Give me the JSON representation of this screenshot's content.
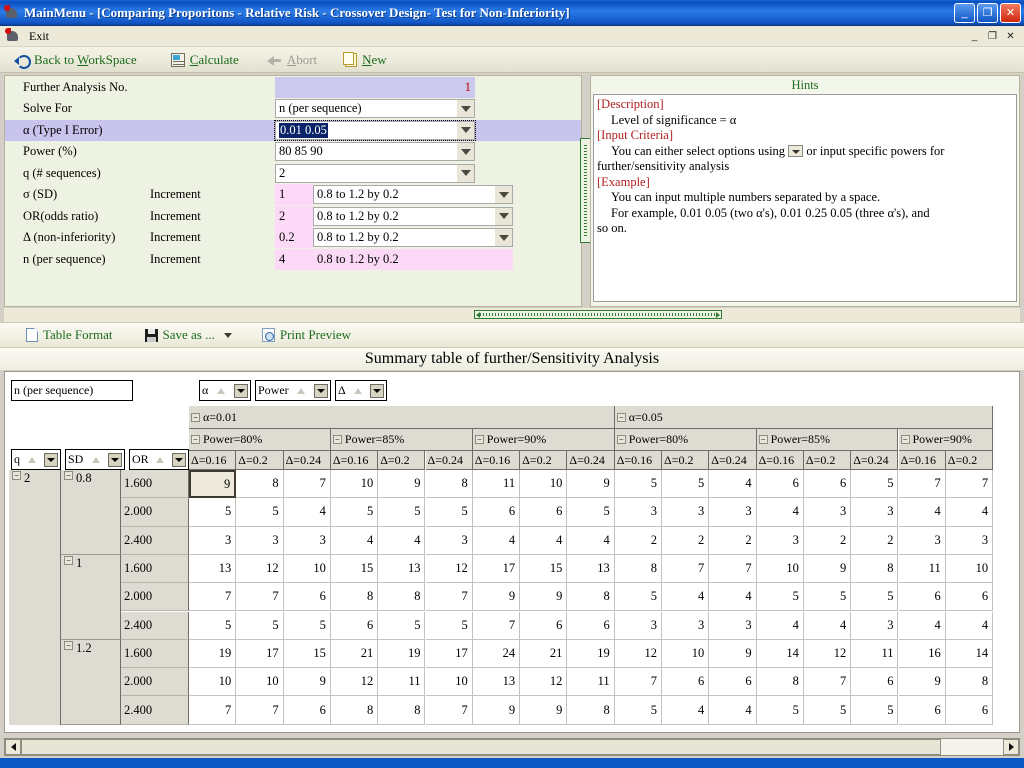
{
  "window": {
    "title": "MainMenu - [Comparing Proporitons - Relative Risk - Crossover Design- Test for Non-Inferiority]",
    "app_icon": "app-icon",
    "minimize": "_",
    "maximize": "❐",
    "close": "✕",
    "mdi_minimize": "_",
    "mdi_restore": "❐",
    "mdi_close": "✕"
  },
  "menu": {
    "exit_label": "Exit",
    "exit_icon": "exit-icon"
  },
  "toolbar": {
    "items": [
      {
        "label_pre": "Back to ",
        "label_u": "W",
        "label_post": "orkSpace",
        "icon": "back-arrow-icon",
        "disabled": false
      },
      {
        "label_pre": "",
        "label_u": "C",
        "label_post": "alculate",
        "icon": "calculate-icon",
        "disabled": false
      },
      {
        "label_pre": "",
        "label_u": "A",
        "label_post": "bort",
        "icon": "abort-icon",
        "disabled": true
      },
      {
        "label_pre": "",
        "label_u": "N",
        "label_post": "ew",
        "icon": "new-document-icon",
        "disabled": false
      }
    ]
  },
  "form": {
    "rows": [
      {
        "name": "Further Analysis No.",
        "increment": "",
        "value": "1",
        "kind": "readonly-number"
      },
      {
        "name": "Solve For",
        "increment": "",
        "value": "n (per sequence)",
        "kind": "combo"
      },
      {
        "name": "α (Type I Error)",
        "increment": "",
        "value": "0.01 0.05",
        "kind": "combo-selected",
        "highlight": true
      },
      {
        "name": "Power (%)",
        "increment": "",
        "value": "80 85 90",
        "kind": "combo"
      },
      {
        "name": "q (# sequences)",
        "increment": "",
        "value": "2",
        "kind": "combo"
      },
      {
        "name": "σ (SD)",
        "increment": "Increment",
        "value": "1",
        "range": "0.8 to 1.2 by 0.2",
        "kind": "inc-combo"
      },
      {
        "name": "OR(odds ratio)",
        "increment": "Increment",
        "value": "2",
        "range": "0.8 to 1.2 by 0.2",
        "kind": "inc-combo"
      },
      {
        "name": "Δ (non-inferiority)",
        "increment": "Increment",
        "value": "0.2",
        "range": "0.8 to 1.2 by 0.2",
        "kind": "inc-combo"
      },
      {
        "name": "n (per sequence)",
        "increment": "Increment",
        "value": "4",
        "range": "0.8 to 1.2 by 0.2",
        "kind": "inc-disabled"
      }
    ]
  },
  "hints": {
    "title": "Hints",
    "lines": [
      {
        "text": "[Description]",
        "style": "head",
        "indent": 0
      },
      {
        "text": "Level of significance = α",
        "style": "body",
        "indent": 1
      },
      {
        "text": "[Input Criteria]",
        "style": "head",
        "indent": 0
      },
      {
        "text": "You can either select options using",
        "style": "body-combo-a",
        "indent": 1
      },
      {
        "text": "or input specific powers for",
        "style": "body-combo-b",
        "indent": 0
      },
      {
        "text": "further/sensitivity analysis",
        "style": "body",
        "indent": 0
      },
      {
        "text": "[Example]",
        "style": "head",
        "indent": 0
      },
      {
        "text": "You can input multiple numbers separated by a space.",
        "style": "body",
        "indent": 1
      },
      {
        "text": "For example, 0.01 0.05 (two α's), 0.01 0.25 0.05 (three α's), and",
        "style": "body",
        "indent": 1
      },
      {
        "text": "so on.",
        "style": "body",
        "indent": 0
      }
    ]
  },
  "lower_toolbar": {
    "items": [
      {
        "label": "Table Format",
        "icon": "document-icon",
        "caret": false
      },
      {
        "label": "Save as ...",
        "icon": "floppy-disk-icon",
        "caret": true
      },
      {
        "label": "Print Preview",
        "icon": "print-preview-icon",
        "caret": false
      }
    ]
  },
  "summary": {
    "title": "Summary table of further/Sensitivity Analysis"
  },
  "pivot": {
    "data_field": "n (per  sequence)",
    "column_fields": [
      {
        "label": "α"
      },
      {
        "label": "Power"
      },
      {
        "label": "Δ"
      }
    ],
    "row_fields": [
      {
        "label": "q"
      },
      {
        "label": "SD"
      },
      {
        "label": "OR"
      }
    ],
    "alpha_groups": [
      {
        "label": "α=0.01",
        "span": 9
      },
      {
        "label": "α=0.05",
        "span": 8
      }
    ],
    "power_groups": [
      {
        "label": "Power=80%",
        "span": 3
      },
      {
        "label": "Power=85%",
        "span": 3
      },
      {
        "label": "Power=90%",
        "span": 3
      },
      {
        "label": "Power=80%",
        "span": 3
      },
      {
        "label": "Power=85%",
        "span": 3
      },
      {
        "label": "Power=90%",
        "span": 2
      }
    ],
    "delta_headers": [
      "Δ=0.16",
      "Δ=0.2",
      "Δ=0.24",
      "Δ=0.16",
      "Δ=0.2",
      "Δ=0.24",
      "Δ=0.16",
      "Δ=0.2",
      "Δ=0.24",
      "Δ=0.16",
      "Δ=0.2",
      "Δ=0.24",
      "Δ=0.16",
      "Δ=0.2",
      "Δ=0.24",
      "Δ=0.16",
      "Δ=0.2"
    ],
    "q_group": "2",
    "sd_groups": [
      {
        "label": "0.8",
        "rows": 3
      },
      {
        "label": "1",
        "rows": 3
      },
      {
        "label": "1.2",
        "rows": 3
      }
    ],
    "or_labels": [
      "1.600",
      "2.000",
      "2.400",
      "1.600",
      "2.000",
      "2.400",
      "1.600",
      "2.000",
      "2.400"
    ],
    "values": [
      [
        9,
        8,
        7,
        10,
        9,
        8,
        11,
        10,
        9,
        5,
        5,
        4,
        6,
        6,
        5,
        7,
        7
      ],
      [
        5,
        5,
        4,
        5,
        5,
        5,
        6,
        6,
        5,
        3,
        3,
        3,
        4,
        3,
        3,
        4,
        4
      ],
      [
        3,
        3,
        3,
        4,
        4,
        3,
        4,
        4,
        4,
        2,
        2,
        2,
        3,
        2,
        2,
        3,
        3
      ],
      [
        13,
        12,
        10,
        15,
        13,
        12,
        17,
        15,
        13,
        8,
        7,
        7,
        10,
        9,
        8,
        11,
        10
      ],
      [
        7,
        7,
        6,
        8,
        8,
        7,
        9,
        9,
        8,
        5,
        4,
        4,
        5,
        5,
        5,
        6,
        6
      ],
      [
        5,
        5,
        5,
        6,
        5,
        5,
        7,
        6,
        6,
        3,
        3,
        3,
        4,
        4,
        3,
        4,
        4
      ],
      [
        19,
        17,
        15,
        21,
        19,
        17,
        24,
        21,
        19,
        12,
        10,
        9,
        14,
        12,
        11,
        16,
        14
      ],
      [
        10,
        10,
        9,
        12,
        11,
        10,
        13,
        12,
        11,
        7,
        6,
        6,
        8,
        7,
        6,
        9,
        8
      ],
      [
        7,
        7,
        6,
        8,
        8,
        7,
        9,
        9,
        8,
        5,
        4,
        4,
        5,
        5,
        5,
        6,
        6
      ]
    ],
    "selected_cell": {
      "row": 0,
      "col": 0
    }
  },
  "colors": {
    "titlebar": "#1668d8",
    "toolbar_text": "#1b6b1b",
    "alpha_label": "#d2004b",
    "hint_head": "#b02020",
    "highlight_row": "#c9c4ee",
    "pink_cell": "#fcd9f6"
  }
}
